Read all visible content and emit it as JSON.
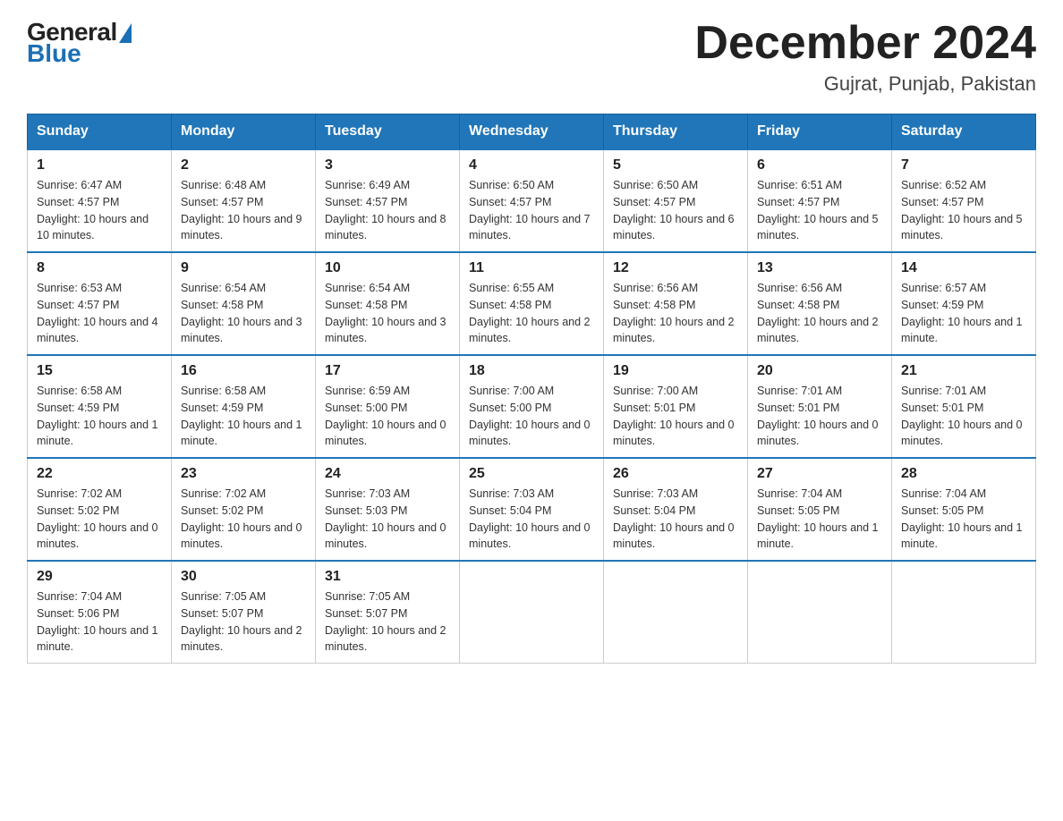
{
  "header": {
    "logo_general": "General",
    "logo_blue": "Blue",
    "month_title": "December 2024",
    "location": "Gujrat, Punjab, Pakistan"
  },
  "days_of_week": [
    "Sunday",
    "Monday",
    "Tuesday",
    "Wednesday",
    "Thursday",
    "Friday",
    "Saturday"
  ],
  "weeks": [
    [
      {
        "day": "1",
        "sunrise": "6:47 AM",
        "sunset": "4:57 PM",
        "daylight": "10 hours and 10 minutes."
      },
      {
        "day": "2",
        "sunrise": "6:48 AM",
        "sunset": "4:57 PM",
        "daylight": "10 hours and 9 minutes."
      },
      {
        "day": "3",
        "sunrise": "6:49 AM",
        "sunset": "4:57 PM",
        "daylight": "10 hours and 8 minutes."
      },
      {
        "day": "4",
        "sunrise": "6:50 AM",
        "sunset": "4:57 PM",
        "daylight": "10 hours and 7 minutes."
      },
      {
        "day": "5",
        "sunrise": "6:50 AM",
        "sunset": "4:57 PM",
        "daylight": "10 hours and 6 minutes."
      },
      {
        "day": "6",
        "sunrise": "6:51 AM",
        "sunset": "4:57 PM",
        "daylight": "10 hours and 5 minutes."
      },
      {
        "day": "7",
        "sunrise": "6:52 AM",
        "sunset": "4:57 PM",
        "daylight": "10 hours and 5 minutes."
      }
    ],
    [
      {
        "day": "8",
        "sunrise": "6:53 AM",
        "sunset": "4:57 PM",
        "daylight": "10 hours and 4 minutes."
      },
      {
        "day": "9",
        "sunrise": "6:54 AM",
        "sunset": "4:58 PM",
        "daylight": "10 hours and 3 minutes."
      },
      {
        "day": "10",
        "sunrise": "6:54 AM",
        "sunset": "4:58 PM",
        "daylight": "10 hours and 3 minutes."
      },
      {
        "day": "11",
        "sunrise": "6:55 AM",
        "sunset": "4:58 PM",
        "daylight": "10 hours and 2 minutes."
      },
      {
        "day": "12",
        "sunrise": "6:56 AM",
        "sunset": "4:58 PM",
        "daylight": "10 hours and 2 minutes."
      },
      {
        "day": "13",
        "sunrise": "6:56 AM",
        "sunset": "4:58 PM",
        "daylight": "10 hours and 2 minutes."
      },
      {
        "day": "14",
        "sunrise": "6:57 AM",
        "sunset": "4:59 PM",
        "daylight": "10 hours and 1 minute."
      }
    ],
    [
      {
        "day": "15",
        "sunrise": "6:58 AM",
        "sunset": "4:59 PM",
        "daylight": "10 hours and 1 minute."
      },
      {
        "day": "16",
        "sunrise": "6:58 AM",
        "sunset": "4:59 PM",
        "daylight": "10 hours and 1 minute."
      },
      {
        "day": "17",
        "sunrise": "6:59 AM",
        "sunset": "5:00 PM",
        "daylight": "10 hours and 0 minutes."
      },
      {
        "day": "18",
        "sunrise": "7:00 AM",
        "sunset": "5:00 PM",
        "daylight": "10 hours and 0 minutes."
      },
      {
        "day": "19",
        "sunrise": "7:00 AM",
        "sunset": "5:01 PM",
        "daylight": "10 hours and 0 minutes."
      },
      {
        "day": "20",
        "sunrise": "7:01 AM",
        "sunset": "5:01 PM",
        "daylight": "10 hours and 0 minutes."
      },
      {
        "day": "21",
        "sunrise": "7:01 AM",
        "sunset": "5:01 PM",
        "daylight": "10 hours and 0 minutes."
      }
    ],
    [
      {
        "day": "22",
        "sunrise": "7:02 AM",
        "sunset": "5:02 PM",
        "daylight": "10 hours and 0 minutes."
      },
      {
        "day": "23",
        "sunrise": "7:02 AM",
        "sunset": "5:02 PM",
        "daylight": "10 hours and 0 minutes."
      },
      {
        "day": "24",
        "sunrise": "7:03 AM",
        "sunset": "5:03 PM",
        "daylight": "10 hours and 0 minutes."
      },
      {
        "day": "25",
        "sunrise": "7:03 AM",
        "sunset": "5:04 PM",
        "daylight": "10 hours and 0 minutes."
      },
      {
        "day": "26",
        "sunrise": "7:03 AM",
        "sunset": "5:04 PM",
        "daylight": "10 hours and 0 minutes."
      },
      {
        "day": "27",
        "sunrise": "7:04 AM",
        "sunset": "5:05 PM",
        "daylight": "10 hours and 1 minute."
      },
      {
        "day": "28",
        "sunrise": "7:04 AM",
        "sunset": "5:05 PM",
        "daylight": "10 hours and 1 minute."
      }
    ],
    [
      {
        "day": "29",
        "sunrise": "7:04 AM",
        "sunset": "5:06 PM",
        "daylight": "10 hours and 1 minute."
      },
      {
        "day": "30",
        "sunrise": "7:05 AM",
        "sunset": "5:07 PM",
        "daylight": "10 hours and 2 minutes."
      },
      {
        "day": "31",
        "sunrise": "7:05 AM",
        "sunset": "5:07 PM",
        "daylight": "10 hours and 2 minutes."
      },
      null,
      null,
      null,
      null
    ]
  ]
}
